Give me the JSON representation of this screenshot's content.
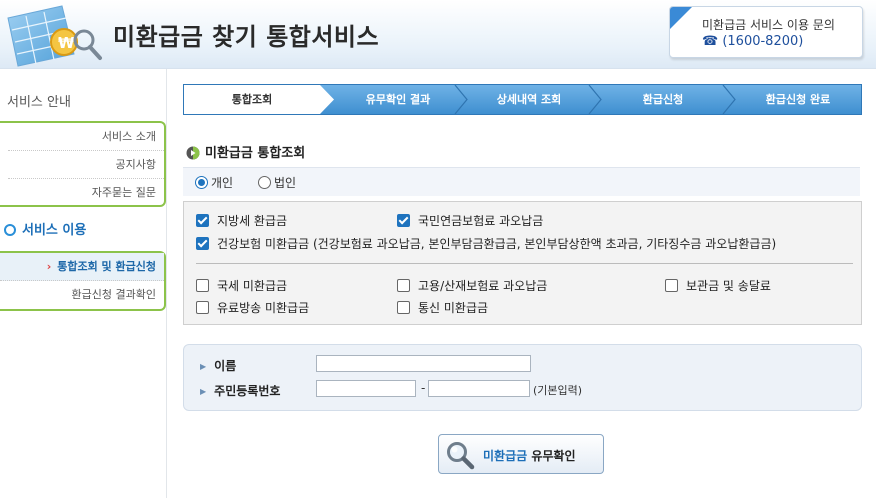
{
  "header": {
    "site_title": "미환급금 찾기 통합서비스",
    "contact_title": "미환급금 서비스 이용 문의",
    "contact_phone": "☎ (1600-8200)",
    "logo_icon": "document-search-icon"
  },
  "sidebar": {
    "info_title": "서비스 안내",
    "info_items": [
      {
        "label": "서비스 소개"
      },
      {
        "label": "공지사항"
      },
      {
        "label": "자주묻는 질문"
      }
    ],
    "use_title": "서비스 이용",
    "use_items": [
      {
        "label": "통합조회 및 환급신청",
        "active": true
      },
      {
        "label": "환급신청 결과확인",
        "active": false
      }
    ],
    "accent_color": "#8cc34a"
  },
  "steps": [
    {
      "label": "통합조회",
      "active": true
    },
    {
      "label": "유무확인 결과",
      "active": false
    },
    {
      "label": "상세내역 조회",
      "active": false
    },
    {
      "label": "환급신청",
      "active": false
    },
    {
      "label": "환급신청 완료",
      "active": false
    }
  ],
  "section": {
    "title": "미환급금 통합조회"
  },
  "user_type": {
    "options": [
      {
        "label": "개인",
        "selected": true
      },
      {
        "label": "법인",
        "selected": false
      }
    ]
  },
  "checkboxes": {
    "local_tax": {
      "label": "지방세 환급금",
      "checked": true
    },
    "national_pension": {
      "label": "국민연금보험료 과오납금",
      "checked": true
    },
    "health_insurance": {
      "label": "건강보험 미환급금 (건강보험료 과오납금, 본인부담금환급금, 본인부담상한액 초과금, 기타징수금 과오납환급금)",
      "checked": true
    },
    "national_tax": {
      "label": "국세 미환급금",
      "checked": false
    },
    "employment_insurance": {
      "label": "고용/산재보험료 과오납금",
      "checked": false
    },
    "storage_fee": {
      "label": "보관금 및 송달료",
      "checked": false
    },
    "cable_broadcast": {
      "label": "유료방송 미환급금",
      "checked": false
    },
    "telecom": {
      "label": "통신 미환급금",
      "checked": false
    }
  },
  "form": {
    "name_label": "이름",
    "name_value": "",
    "jumin_label": "주민등록번호",
    "jumin_front": "",
    "jumin_back": "",
    "dash": "-",
    "jumin_hint": "(기본입력)"
  },
  "button": {
    "label_highlight": "미환급금",
    "label_rest": " 유무확인",
    "icon": "magnifier-icon"
  },
  "colors": {
    "step_blue": "#4a9ad9",
    "primary_blue": "#1e73be"
  }
}
